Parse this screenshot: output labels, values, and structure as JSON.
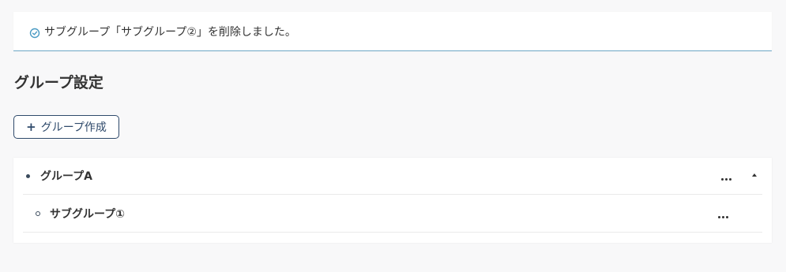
{
  "notice": {
    "icon": "check-circle-icon",
    "text": "サブグループ「サブグループ②」を削除しました。"
  },
  "page": {
    "title": "グループ設定"
  },
  "toolbar": {
    "create_button_icon": "plus-icon",
    "create_button_label": "グループ作成"
  },
  "groups": [
    {
      "name": "グループA",
      "expanded": true,
      "subgroups": [
        {
          "name": "サブグループ①"
        }
      ]
    }
  ],
  "colors": {
    "accent_border": "#6ea8c7",
    "button_border": "#2f4a6b",
    "background": "#f8f8f9",
    "success_icon": "#4b9bc4"
  }
}
